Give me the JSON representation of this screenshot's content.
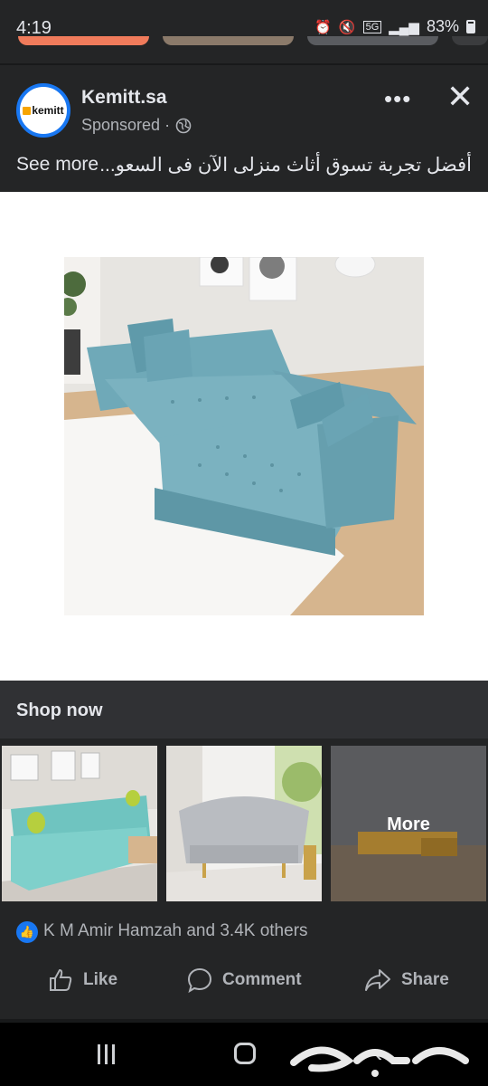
{
  "status_bar": {
    "time": "4:19",
    "network": "5G",
    "battery": "83%",
    "icons": [
      "alarm-icon",
      "mute-icon",
      "signal-icon",
      "battery-icon"
    ]
  },
  "post": {
    "page_name": "Kemitt.sa",
    "avatar_logo_text": "kemitt",
    "sponsored_label": "Sponsored · ",
    "caption": "أفضل تجربة تسوق أثاث منزلى الآن فى السعو...",
    "see_more": "See more",
    "ad_image_description_icon": "sofa-image",
    "shop_now_label": "Shop now",
    "carousel": {
      "more_label": "More"
    },
    "reactions_text": "K M Amir Hamzah and 3.4K others",
    "actions": {
      "like": "Like",
      "comment": "Comment",
      "share": "Share"
    }
  },
  "colors": {
    "background": "#242526",
    "accent": "#1877f2",
    "text": "#e4e6eb",
    "muted": "#b0b3b8",
    "sofa": "#6fa9b8"
  },
  "watermark": "حراج"
}
